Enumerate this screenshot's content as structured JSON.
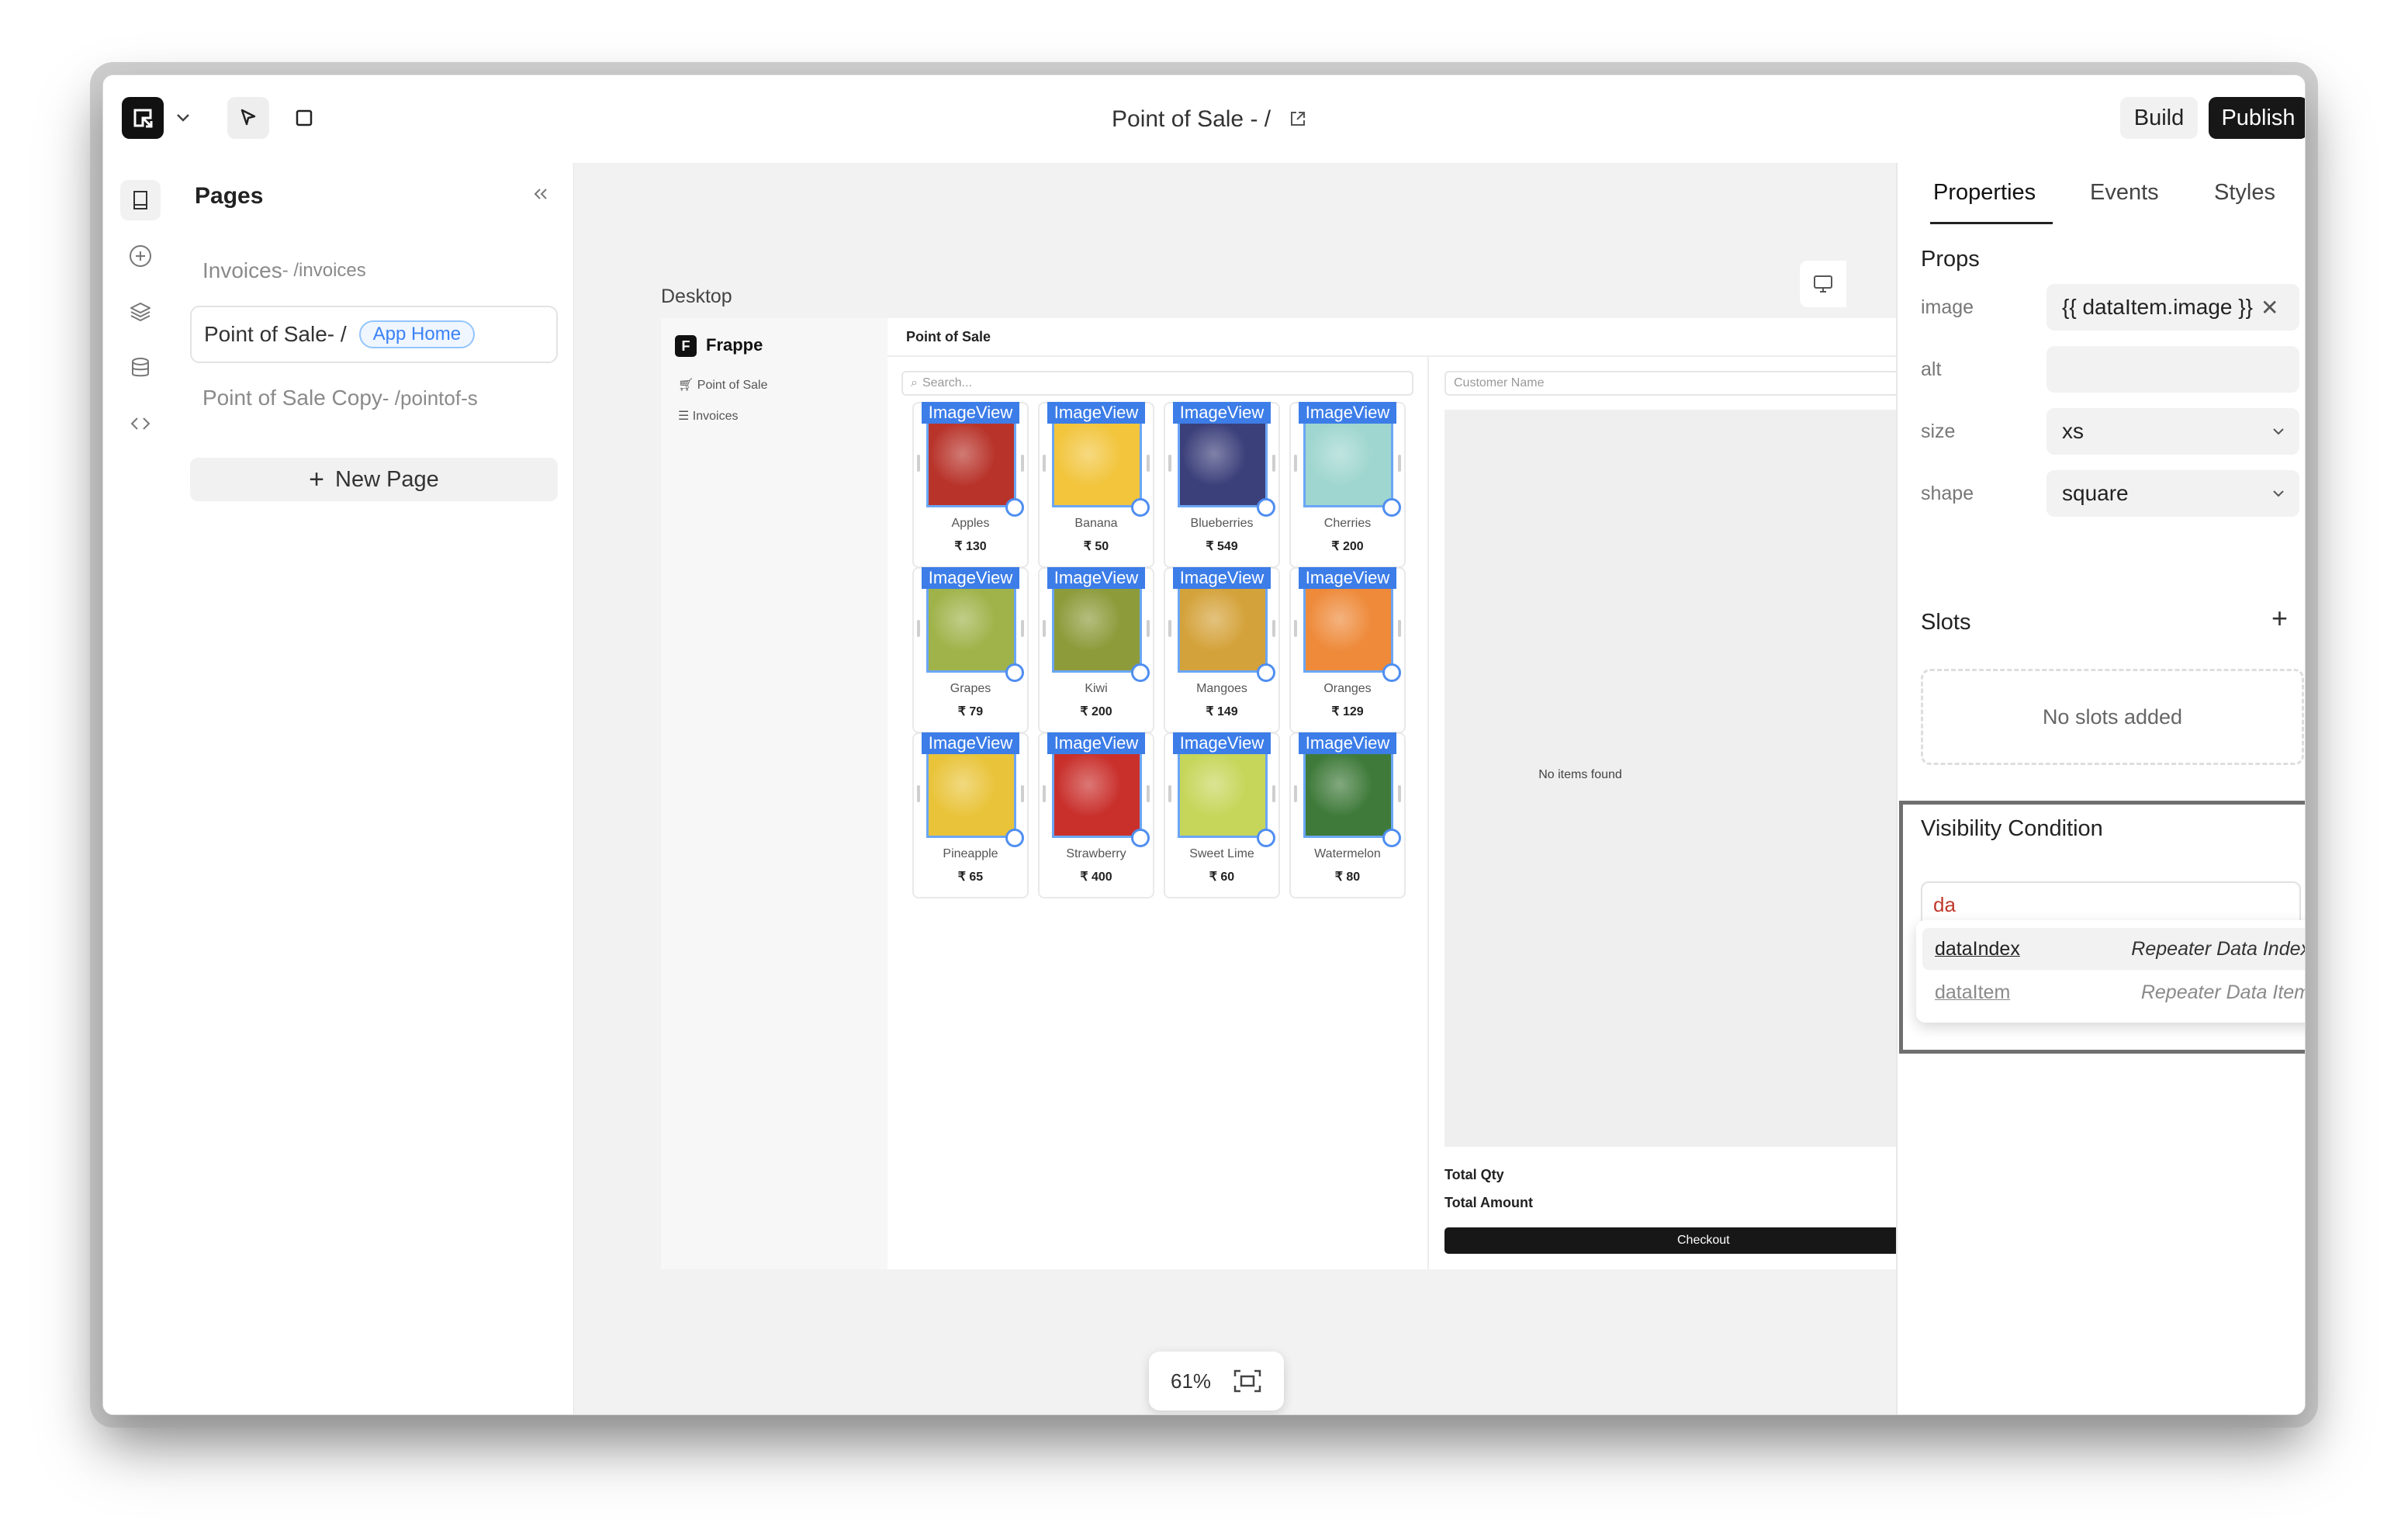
{
  "topbar": {
    "title": "Point of Sale - /",
    "build_label": "Build",
    "publish_label": "Publish"
  },
  "pages_panel": {
    "title": "Pages",
    "items": [
      {
        "name": "Invoices",
        "route": " - /invoices"
      },
      {
        "name": "Point of Sale",
        "route": " - /",
        "badge": "App Home"
      },
      {
        "name": "Point of Sale Copy",
        "route": " - /pointof-s"
      }
    ],
    "new_page_label": "New Page"
  },
  "canvas": {
    "device_label": "Desktop",
    "zoom": "61%",
    "app": {
      "brand": "Frappe",
      "nav": [
        "Point of Sale",
        "Invoices"
      ],
      "page_title": "Point of Sale",
      "search_placeholder": "Search...",
      "customer_placeholder": "Customer Name",
      "empty_text": "No items found",
      "total_qty_label": "Total Qty",
      "total_amount_label": "Total Amount",
      "checkout_label": "Checkout",
      "image_tag": "ImageView",
      "products": [
        {
          "name": "Apples",
          "price": "₹ 130",
          "color": "#b8342b"
        },
        {
          "name": "Banana",
          "price": "₹ 50",
          "color": "#f2c53d"
        },
        {
          "name": "Blueberries",
          "price": "₹ 549",
          "color": "#3b3f7a"
        },
        {
          "name": "Cherries",
          "price": "₹ 200",
          "color": "#9fd6cf"
        },
        {
          "name": "Grapes",
          "price": "₹ 79",
          "color": "#9fb34a"
        },
        {
          "name": "Kiwi",
          "price": "₹ 200",
          "color": "#8d9b3a"
        },
        {
          "name": "Mangoes",
          "price": "₹ 149",
          "color": "#d4a23a"
        },
        {
          "name": "Oranges",
          "price": "₹ 129",
          "color": "#ee8a3a"
        },
        {
          "name": "Pineapple",
          "price": "₹ 65",
          "color": "#e9c43b"
        },
        {
          "name": "Strawberry",
          "price": "₹ 400",
          "color": "#c9302c"
        },
        {
          "name": "Sweet Lime",
          "price": "₹ 60",
          "color": "#c6d65a"
        },
        {
          "name": "Watermelon",
          "price": "₹ 80",
          "color": "#3f7a3a"
        }
      ]
    }
  },
  "properties_panel": {
    "tabs": [
      "Properties",
      "Events",
      "Styles"
    ],
    "props_title": "Props",
    "props": [
      {
        "label": "image",
        "value": "{{ dataItem.image }}"
      },
      {
        "label": "alt",
        "value": ""
      },
      {
        "label": "size",
        "value": "xs"
      },
      {
        "label": "shape",
        "value": "square"
      }
    ],
    "slots_title": "Slots",
    "slots_empty": "No slots added",
    "visibility_title": "Visibility Condition",
    "visibility_value": "da",
    "suggestions": [
      {
        "key": "dataIndex",
        "desc": "Repeater Data Index"
      },
      {
        "key": "dataItem",
        "desc": "Repeater Data Item"
      }
    ]
  }
}
